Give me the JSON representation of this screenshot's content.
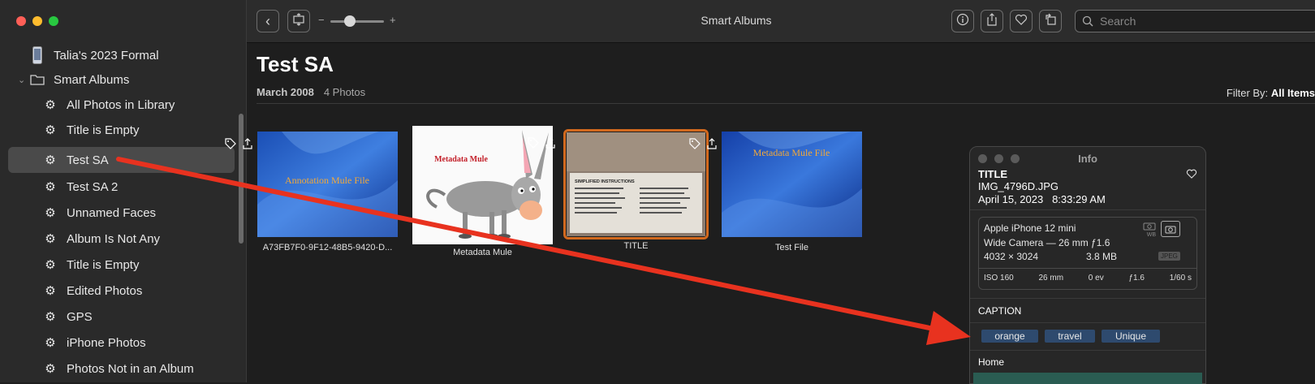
{
  "sidebar": {
    "items": [
      {
        "label": "Talia's 2023 Formal",
        "icon": "phone-icon"
      },
      {
        "label": "Smart Albums",
        "icon": "folder-icon"
      },
      {
        "label": "All Photos in Library",
        "icon": "gear-icon"
      },
      {
        "label": "Title is Empty",
        "icon": "gear-icon"
      },
      {
        "label": "Test SA",
        "icon": "gear-icon",
        "selected": true
      },
      {
        "label": "Test SA 2",
        "icon": "gear-icon"
      },
      {
        "label": "Unnamed Faces",
        "icon": "gear-icon"
      },
      {
        "label": "Album Is Not Any",
        "icon": "gear-icon"
      },
      {
        "label": "Title is Empty",
        "icon": "gear-icon"
      },
      {
        "label": "Edited Photos",
        "icon": "gear-icon"
      },
      {
        "label": "GPS",
        "icon": "gear-icon"
      },
      {
        "label": "iPhone Photos",
        "icon": "gear-icon"
      },
      {
        "label": "Photos Not in an Album",
        "icon": "gear-icon"
      }
    ]
  },
  "toolbar": {
    "title": "Smart Albums",
    "zoom_minus": "−",
    "zoom_plus": "+",
    "search_placeholder": "Search"
  },
  "main": {
    "title": "Test SA",
    "date": "March 2008",
    "count": "4 Photos",
    "filter_label": "Filter By:",
    "filter_value": "All Items"
  },
  "photos": [
    {
      "caption": "A73FB7F0-9F12-48B5-9420-D...",
      "overlay_text": "Annotation Mule File"
    },
    {
      "caption": "Metadata Mule",
      "overlay_text": "Metadata Mule"
    },
    {
      "caption": "TITLE",
      "overlay_text": "SIMPLIFIED INSTRUCTIONS",
      "selected": true
    },
    {
      "caption": "Test File",
      "overlay_text": "Metadata Mule File"
    }
  ],
  "info": {
    "window_title": "Info",
    "title": "TITLE",
    "filename": "IMG_4796D.JPG",
    "date": "April 15, 2023",
    "time": "8:33:29 AM",
    "camera": "Apple iPhone 12 mini",
    "lens": "Wide Camera — 26 mm ƒ1.6",
    "dimensions": "4032 × 3024",
    "filesize": "3.8 MB",
    "format": "JPEG",
    "wb_badge": "WB",
    "exif": {
      "iso": "ISO 160",
      "focal": "26 mm",
      "ev": "0 ev",
      "aperture": "ƒ1.6",
      "shutter": "1/60 s"
    },
    "caption_label": "CAPTION",
    "keywords": [
      "orange",
      "travel",
      "Unique"
    ],
    "location": "Home"
  },
  "colors": {
    "arrow": "#e8321f",
    "accent_selected": "#d2691e"
  }
}
